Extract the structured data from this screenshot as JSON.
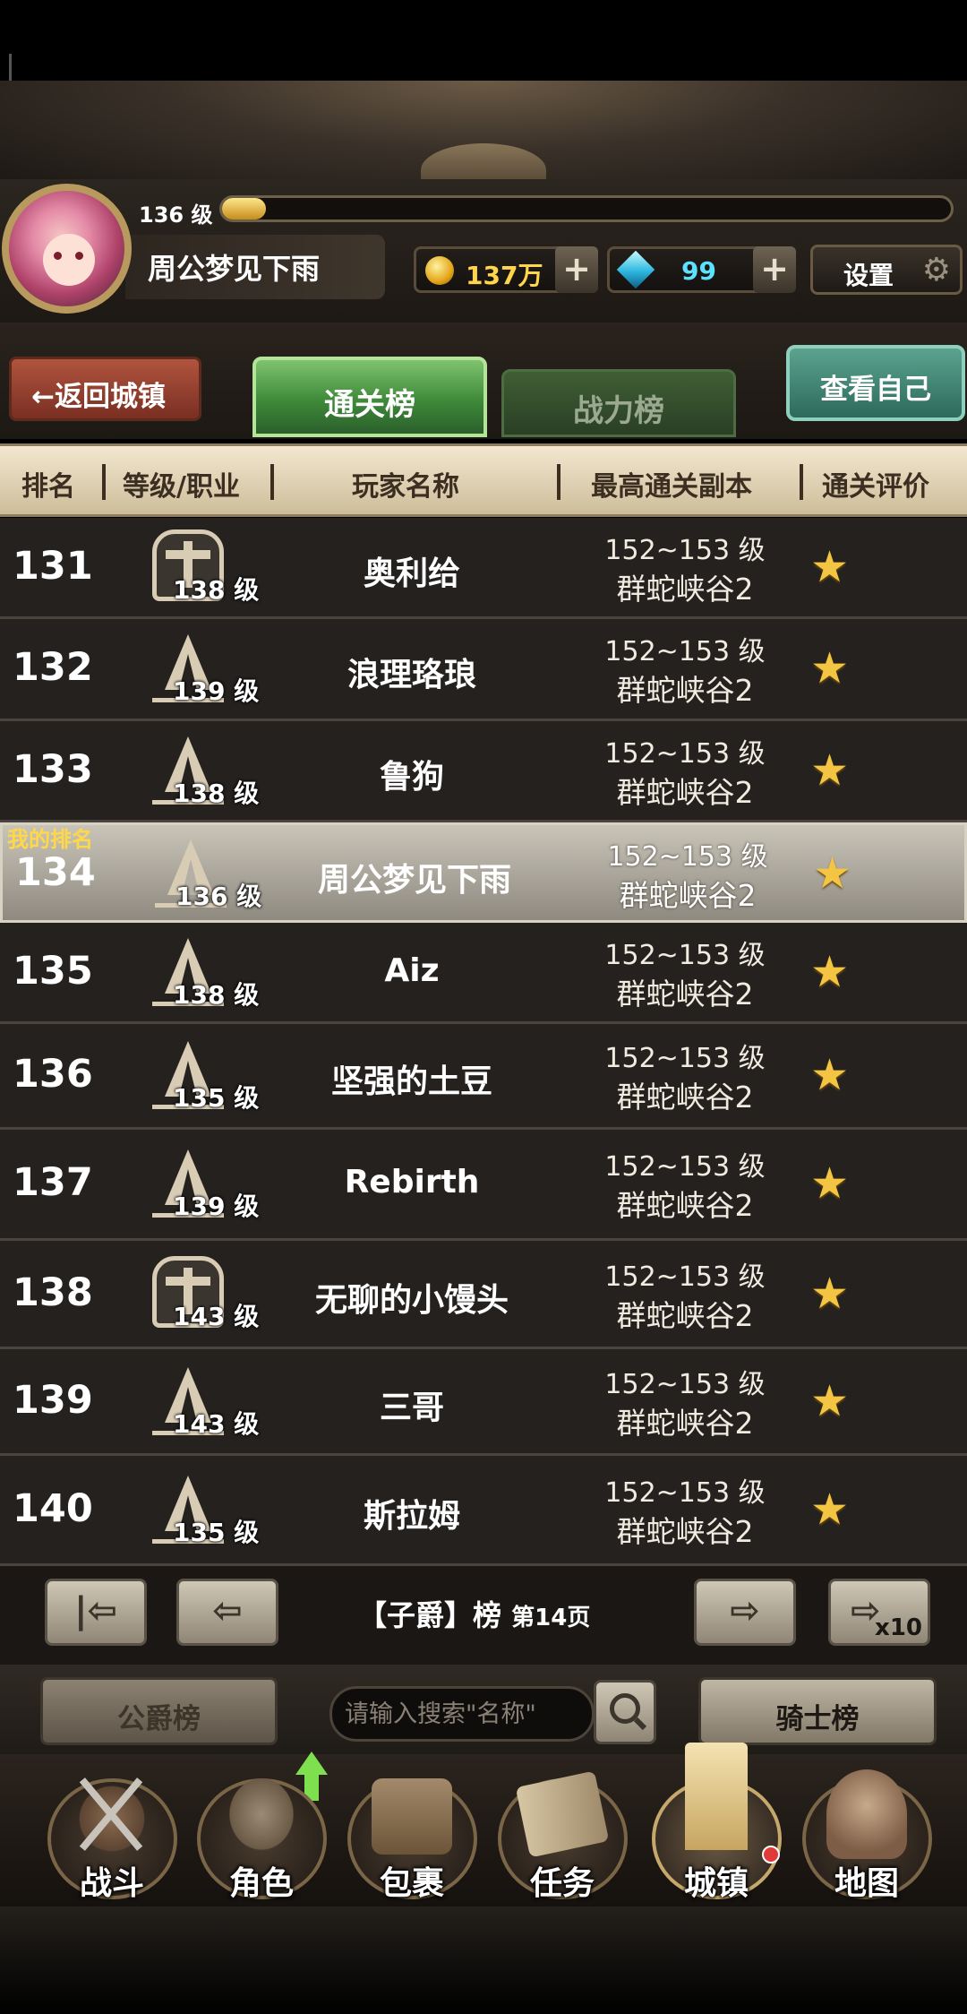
{
  "player": {
    "level_label": "136 级",
    "name": "周公梦见下雨",
    "xp_fraction": 0.06
  },
  "resources": {
    "gold": "137万",
    "gems": "99",
    "settings_label": "设置"
  },
  "nav": {
    "back_label": "←返回城镇",
    "tabs": [
      "通关榜",
      "战力榜"
    ],
    "view_self_label": "查看自己"
  },
  "columns": [
    "排名",
    "等级/职业",
    "玩家名称",
    "最高通关副本",
    "通关评价"
  ],
  "my_rank_tag": "我的排名",
  "rows": [
    {
      "rank": "131",
      "cls": "shield",
      "level": "138 级",
      "name": "奥利给",
      "range": "152~153 级",
      "stage": "群蛇峡谷2",
      "star": "★"
    },
    {
      "rank": "132",
      "cls": "flame",
      "level": "139 级",
      "name": "浪理珞琅",
      "range": "152~153 级",
      "stage": "群蛇峡谷2",
      "star": "★"
    },
    {
      "rank": "133",
      "cls": "flame",
      "level": "138 级",
      "name": "鲁狗",
      "range": "152~153 级",
      "stage": "群蛇峡谷2",
      "star": "★"
    },
    {
      "rank": "134",
      "cls": "flame",
      "level": "136 级",
      "name": "周公梦见下雨",
      "range": "152~153 级",
      "stage": "群蛇峡谷2",
      "star": "★",
      "mine": true
    },
    {
      "rank": "135",
      "cls": "flame",
      "level": "138 级",
      "name": "Aiz",
      "range": "152~153 级",
      "stage": "群蛇峡谷2",
      "star": "★"
    },
    {
      "rank": "136",
      "cls": "flame",
      "level": "135 级",
      "name": "坚强的土豆",
      "range": "152~153 级",
      "stage": "群蛇峡谷2",
      "star": "★"
    },
    {
      "rank": "137",
      "cls": "flame",
      "level": "139 级",
      "name": "Rebirth",
      "range": "152~153 级",
      "stage": "群蛇峡谷2",
      "star": "★"
    },
    {
      "rank": "138",
      "cls": "shield",
      "level": "143 级",
      "name": "无聊的小馒头",
      "range": "152~153 级",
      "stage": "群蛇峡谷2",
      "star": "★"
    },
    {
      "rank": "139",
      "cls": "flame",
      "level": "143 级",
      "name": "三哥",
      "range": "152~153 级",
      "stage": "群蛇峡谷2",
      "star": "★"
    },
    {
      "rank": "140",
      "cls": "flame",
      "level": "135 级",
      "name": "斯拉姆",
      "range": "152~153 级",
      "stage": "群蛇峡谷2",
      "star": "★"
    }
  ],
  "pager": {
    "title": "【子爵】榜",
    "page": "第14页",
    "first_icon": "|⇦",
    "prev_icon": "⇦",
    "next_icon": "⇨",
    "next10_icon": "⇨",
    "next10_label": "x10"
  },
  "search": {
    "duke_label": "公爵榜",
    "placeholder": "请输入搜索\"名称\"",
    "knight_label": "骑士榜"
  },
  "bottom_nav": [
    {
      "label": "战斗",
      "icon": "battle"
    },
    {
      "label": "角色",
      "icon": "role"
    },
    {
      "label": "包裹",
      "icon": "bag"
    },
    {
      "label": "任务",
      "icon": "quest"
    },
    {
      "label": "城镇",
      "icon": "town",
      "active": true
    },
    {
      "label": "地图",
      "icon": "map"
    }
  ]
}
